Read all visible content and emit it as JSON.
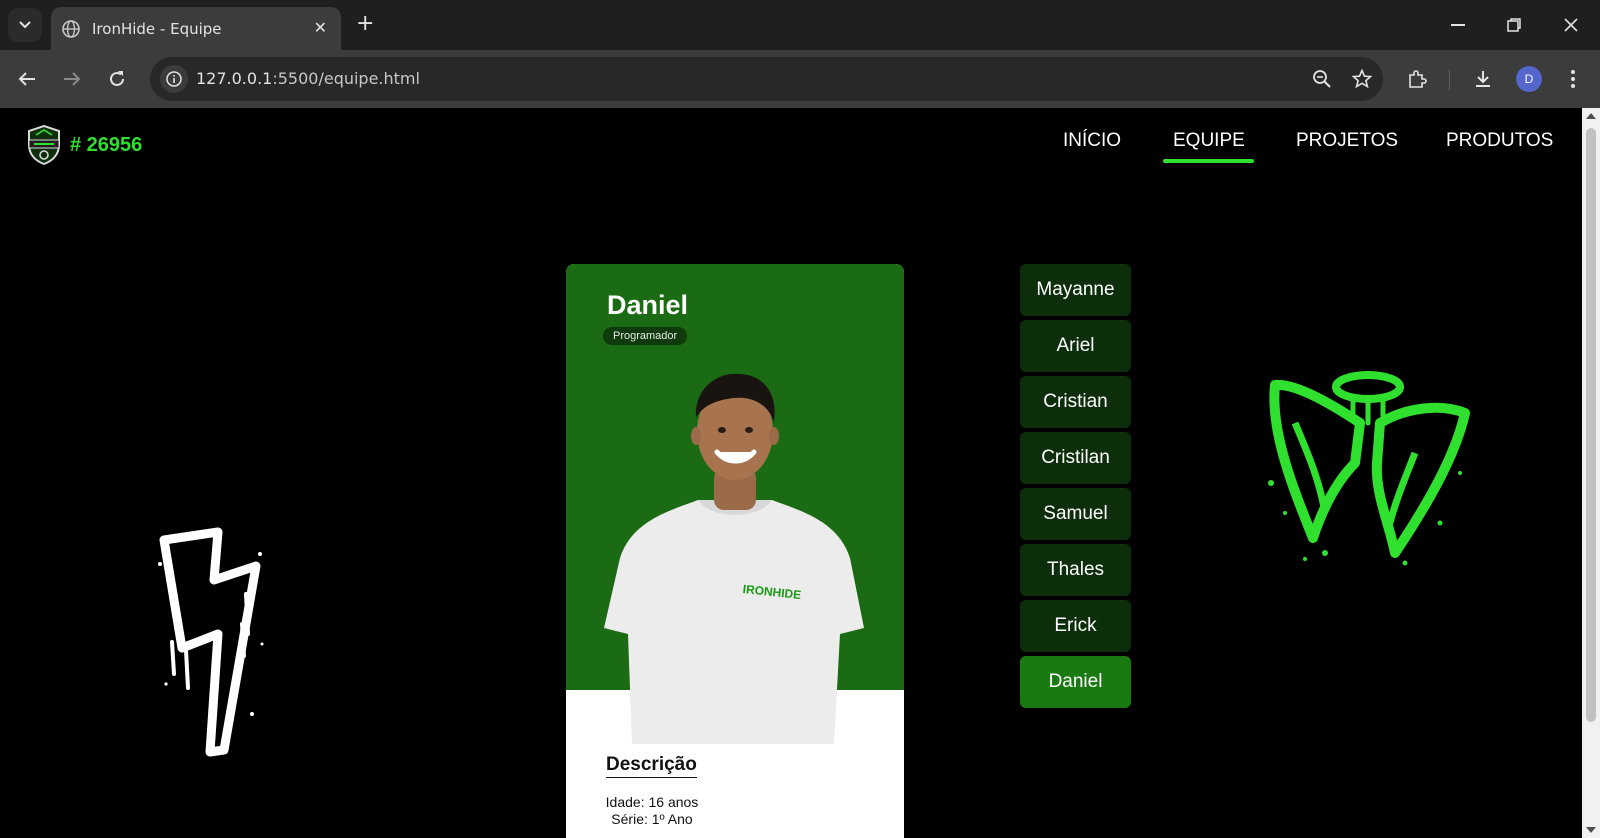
{
  "browser": {
    "tab_title": "IronHide - Equipe",
    "new_tab_label": "+",
    "url_host": "127.0.0.1",
    "url_rest": ":5500/equipe.html",
    "profile_initial": "D"
  },
  "site": {
    "team_number": "# 26956",
    "nav": [
      {
        "label": "INÍCIO",
        "active": false
      },
      {
        "label": "EQUIPE",
        "active": true
      },
      {
        "label": "PROJETOS",
        "active": false
      },
      {
        "label": "PRODUTOS",
        "active": false
      }
    ],
    "accent_color": "#2fe02f"
  },
  "card": {
    "name": "Daniel",
    "role": "Programador",
    "description_title": "Descrição",
    "age": "Idade: 16 anos",
    "grade": "Série: 1º Ano",
    "shirt_logo_text": "IRONHIDE"
  },
  "members": [
    {
      "name": "Mayanne",
      "active": false
    },
    {
      "name": "Ariel",
      "active": false
    },
    {
      "name": "Cristian",
      "active": false
    },
    {
      "name": "Cristilan",
      "active": false
    },
    {
      "name": "Samuel",
      "active": false
    },
    {
      "name": "Thales",
      "active": false
    },
    {
      "name": "Erick",
      "active": false
    },
    {
      "name": "Daniel",
      "active": true
    }
  ]
}
